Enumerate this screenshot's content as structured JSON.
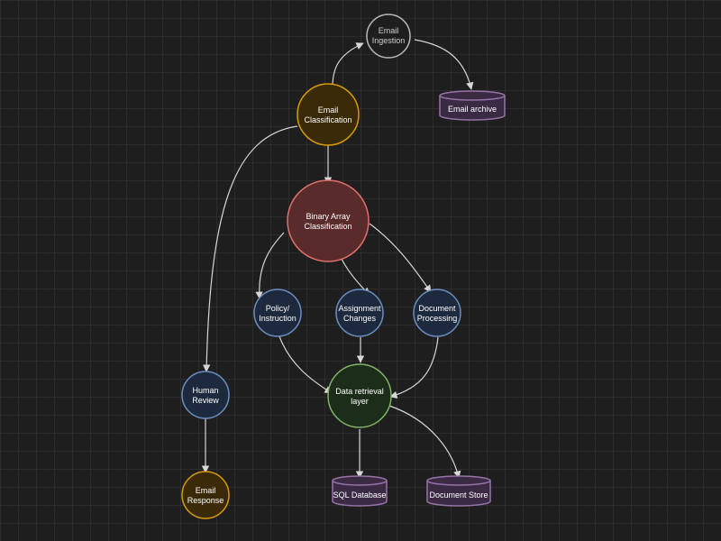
{
  "nodes": {
    "email_ingestion": {
      "lines": [
        "Email",
        "Ingestion"
      ],
      "stroke": "#b9b9b9",
      "fill": "#1e1e1e"
    },
    "email_archive": {
      "lines": [
        "Email archive"
      ],
      "stroke": "#9673a6",
      "fill": "#3a2a44"
    },
    "email_classification": {
      "lines": [
        "Email",
        "Classification"
      ],
      "stroke": "#d79b00",
      "fill": "#3b2a08"
    },
    "binary_array": {
      "lines": [
        "Binary Array",
        "Classification"
      ],
      "stroke": "#e0706b",
      "fill": "#5a2b2b"
    },
    "policy_instruction": {
      "lines": [
        "Policy/",
        "Instruction"
      ],
      "stroke": "#6c8ebf",
      "fill": "#1d2a3d"
    },
    "assignment_changes": {
      "lines": [
        "Assignment",
        "Changes"
      ],
      "stroke": "#6c8ebf",
      "fill": "#1d2a3d"
    },
    "document_processing": {
      "lines": [
        "Document",
        "Processing"
      ],
      "stroke": "#6c8ebf",
      "fill": "#1d2a3d"
    },
    "human_review": {
      "lines": [
        "Human",
        "Review"
      ],
      "stroke": "#6c8ebf",
      "fill": "#1d2a3d"
    },
    "data_retrieval": {
      "lines": [
        "Data retrieval",
        "layer"
      ],
      "stroke": "#82b366",
      "fill": "#1c2e1a"
    },
    "email_response": {
      "lines": [
        "Email",
        "Response"
      ],
      "stroke": "#d79b00",
      "fill": "#3b2a08"
    },
    "sql_database": {
      "lines": [
        "SQL Database"
      ],
      "stroke": "#9673a6",
      "fill": "#3a2a44"
    },
    "document_store": {
      "lines": [
        "Document Store"
      ],
      "stroke": "#9673a6",
      "fill": "#3a2a44"
    }
  },
  "edges": [
    {
      "from": "email_classification",
      "to": "email_ingestion"
    },
    {
      "from": "email_ingestion",
      "to": "email_archive"
    },
    {
      "from": "email_classification",
      "to": "binary_array"
    },
    {
      "from": "email_classification",
      "to": "human_review"
    },
    {
      "from": "binary_array",
      "to": "policy_instruction"
    },
    {
      "from": "binary_array",
      "to": "assignment_changes"
    },
    {
      "from": "binary_array",
      "to": "document_processing"
    },
    {
      "from": "policy_instruction",
      "to": "data_retrieval"
    },
    {
      "from": "assignment_changes",
      "to": "data_retrieval"
    },
    {
      "from": "document_processing",
      "to": "data_retrieval"
    },
    {
      "from": "data_retrieval",
      "to": "sql_database"
    },
    {
      "from": "data_retrieval",
      "to": "document_store"
    },
    {
      "from": "human_review",
      "to": "email_response"
    }
  ],
  "edge_color": "#d6d6d6"
}
